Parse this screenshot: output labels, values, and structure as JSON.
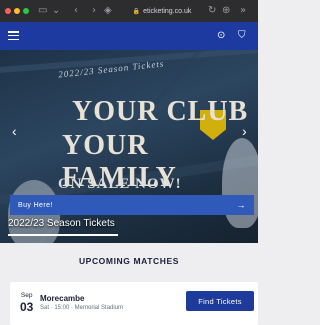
{
  "browser": {
    "url": "eticketing.co.uk",
    "icons": [
      "sidebar-icon",
      "chevron-down-icon",
      "back-icon",
      "forward-icon",
      "shield-icon",
      "lock-icon",
      "reload-icon",
      "download-icon",
      "more-icon"
    ]
  },
  "header": {
    "icons": [
      "menu-icon",
      "account-icon",
      "basket-icon"
    ]
  },
  "hero": {
    "subtitle": "2022/23 Season Tickets",
    "headline_line1": "YOUR CLUB",
    "headline_line2": "YOUR FAMILY",
    "headline_line3": "ON SALE NOW!",
    "caption": "2022/23 Season Tickets",
    "buy_label": "Buy Here!",
    "buy_arrow": "→"
  },
  "upcoming": {
    "title": "UPCOMING MATCHES",
    "matches": [
      {
        "month": "Sep",
        "day": "03",
        "opponent": "Morecambe",
        "details": "Sat · 15:00 · Memorial Stadium",
        "button_label": "Find Tickets"
      }
    ]
  },
  "colors": {
    "header_bg": "#1d3aa0",
    "buy_bar": "#2f5ab9",
    "button": "#1e3a9a",
    "page_bg": "#eeeef1"
  }
}
